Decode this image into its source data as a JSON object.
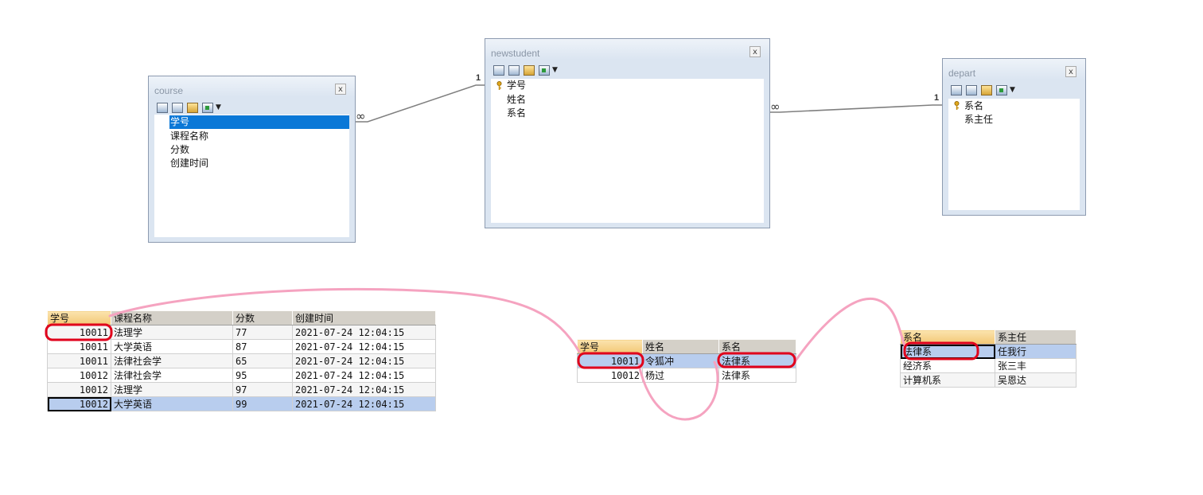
{
  "diagram": {
    "course": {
      "name": "course",
      "close": "x",
      "fields": [
        "学号",
        "课程名称",
        "分数",
        "创建时间"
      ],
      "selected_field": "学号"
    },
    "newstudent": {
      "name": "newstudent",
      "close": "x",
      "fields": [
        "学号",
        "姓名",
        "系名"
      ],
      "key_field": "学号"
    },
    "depart": {
      "name": "depart",
      "close": "x",
      "fields": [
        "系名",
        "系主任"
      ],
      "key_field": "系名"
    },
    "relations": [
      {
        "from": "course",
        "to": "newstudent",
        "from_card": "∞",
        "to_card": "1"
      },
      {
        "from": "newstudent",
        "to": "depart",
        "from_card": "∞",
        "to_card": "1"
      }
    ],
    "toolbar_icons": [
      "table-icon",
      "columns-icon",
      "key-icon",
      "add-field-icon"
    ]
  },
  "grids": {
    "course": {
      "headers": [
        "学号",
        "课程名称",
        "分数",
        "创建时间"
      ],
      "rows": [
        [
          "10011",
          "法理学",
          "77",
          "2021-07-24 12:04:15"
        ],
        [
          "10011",
          "大学英语",
          "87",
          "2021-07-24 12:04:15"
        ],
        [
          "10011",
          "法律社会学",
          "65",
          "2021-07-24 12:04:15"
        ],
        [
          "10012",
          "法律社会学",
          "95",
          "2021-07-24 12:04:15"
        ],
        [
          "10012",
          "法理学",
          "97",
          "2021-07-24 12:04:15"
        ],
        [
          "10012",
          "大学英语",
          "99",
          "2021-07-24 12:04:15"
        ]
      ]
    },
    "newstudent": {
      "headers": [
        "学号",
        "姓名",
        "系名"
      ],
      "rows": [
        [
          "10011",
          "令狐冲",
          "法律系"
        ],
        [
          "10012",
          "杨过",
          "法律系"
        ]
      ]
    },
    "depart": {
      "headers": [
        "系名",
        "系主任"
      ],
      "rows": [
        [
          "法律系",
          "任我行"
        ],
        [
          "经济系",
          "张三丰"
        ],
        [
          "计算机系",
          "吴恩达"
        ]
      ]
    }
  },
  "colors": {
    "selection": "#0a78d7",
    "row_highlight": "#b8cdee",
    "annotation_red": "#e0001b",
    "annotation_pink": "#f5a3c0",
    "header_gold": "#f2c774"
  }
}
